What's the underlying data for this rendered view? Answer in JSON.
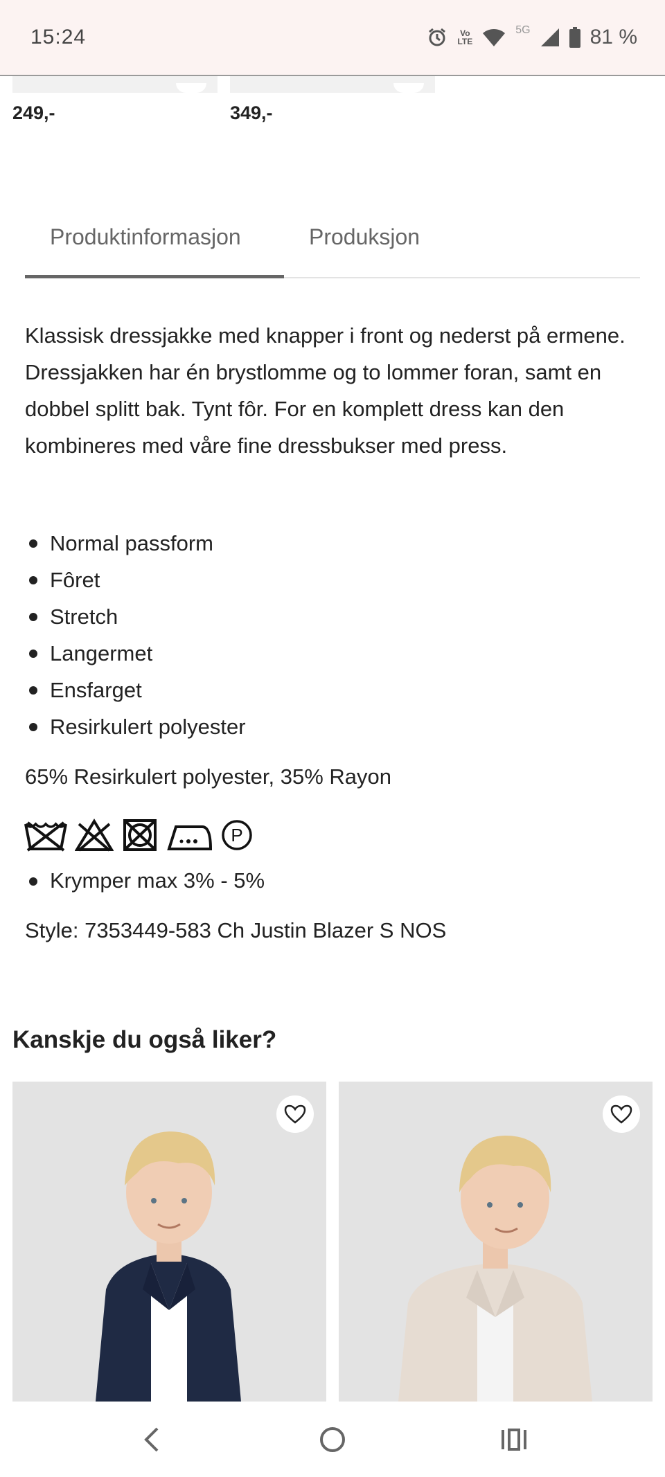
{
  "status_bar": {
    "time": "15:24",
    "volte": "VoLTE",
    "network": "5G",
    "battery": "81 %",
    "icons": [
      "alarm-icon",
      "volte-icon",
      "wifi-icon",
      "signal-icon",
      "battery-icon"
    ]
  },
  "top_products": [
    {
      "price": "249,-"
    },
    {
      "price": "349,-"
    }
  ],
  "tabs": [
    {
      "label": "Produktinformasjon",
      "active": true
    },
    {
      "label": "Produksjon",
      "active": false
    }
  ],
  "description": "Klassisk dressjakke med knapper i front og nederst på ermene. Dressjakken har én brystlomme og to lommer foran, samt en dobbel splitt bak. Tynt fôr. For en komplett dress kan den kombineres med våre fine dressbukser med press.",
  "features": [
    "Normal passform",
    "Fôret",
    "Stretch",
    "Langermet",
    "Ensfarget",
    "Resirkulert polyester"
  ],
  "material": "65% Resirkulert polyester, 35% Rayon",
  "care_icons": [
    "no-wash-icon",
    "no-bleach-icon",
    "no-tumble-dry-icon",
    "iron-low-icon",
    "dry-clean-p-icon"
  ],
  "care_symbol_text": "P",
  "care_notes": [
    "Krymper max 3% - 5%"
  ],
  "style": "Style: 7353449-583 Ch Justin Blazer S NOS",
  "recommendations": {
    "title": "Kanskje du også liker?",
    "items": [
      {
        "image": "boy-navy-blazer",
        "jacket_color": "#1f2a44",
        "shirt_color": "#ffffff"
      },
      {
        "image": "boy-beige-blazer",
        "jacket_color": "#e6dcd2",
        "shirt_color": "#f4f4f4"
      }
    ]
  },
  "nav_bar": {
    "buttons": [
      "back-icon",
      "home-icon",
      "recents-icon"
    ]
  }
}
